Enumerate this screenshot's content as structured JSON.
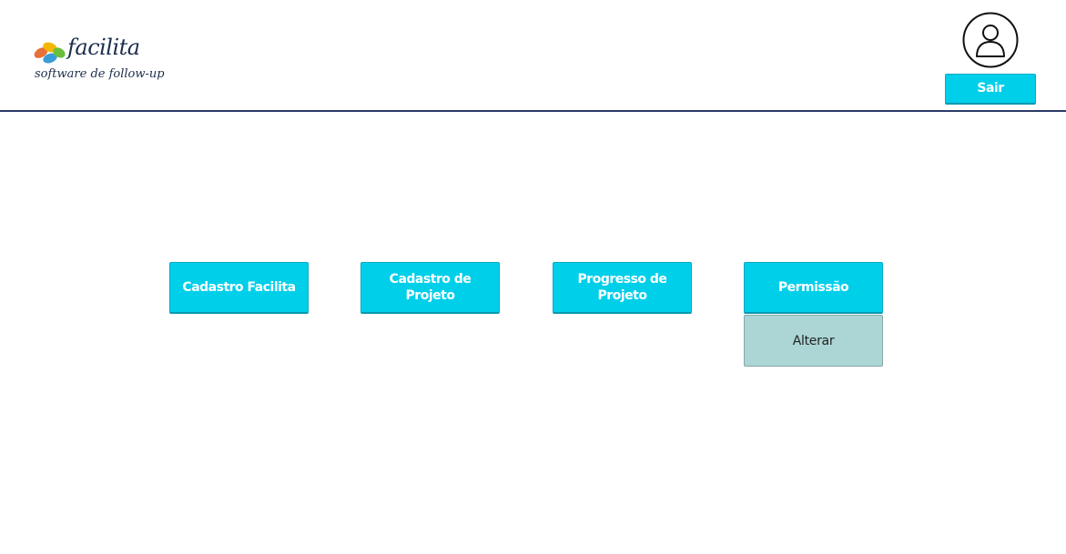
{
  "header": {
    "logo": {
      "name": "facilita",
      "tagline": "software de follow-up",
      "mark_colors": [
        "#e8703a",
        "#f2b705",
        "#3b9dd8",
        "#6bbf3b"
      ]
    },
    "user": {
      "avatar_icon": "user-icon",
      "logout_label": "Sair"
    },
    "divider_color": "#2b3a67"
  },
  "menu": {
    "items": [
      {
        "label": "Cadastro Facilita"
      },
      {
        "label": "Cadastro de Projeto"
      },
      {
        "label": "Progresso de Projeto"
      },
      {
        "label": "Permissão"
      }
    ],
    "submenu": {
      "label": "Alterar"
    }
  },
  "colors": {
    "primary_button": "#00cfea",
    "secondary_button": "#acd6d6"
  }
}
